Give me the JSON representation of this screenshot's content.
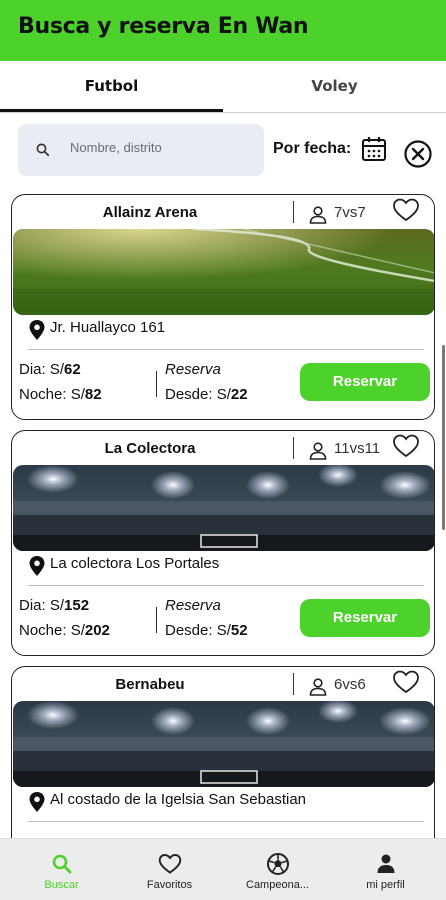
{
  "header": {
    "title": "Busca y reserva  En Wan"
  },
  "tabs": [
    {
      "label": "Futbol",
      "active": true
    },
    {
      "label": "Voley",
      "active": false
    }
  ],
  "search": {
    "placeholder": "Nombre, distrito",
    "icon": "search-icon"
  },
  "date_filter": {
    "label": "Por fecha:",
    "icon": "calendar-icon",
    "clear_icon": "close-circle-icon"
  },
  "cards": [
    {
      "name": "Allainz Arena",
      "capacity": "7vs7",
      "image": "grass-field",
      "address": "Jr. Huallayco  161",
      "day_label": "Dia: S/",
      "day_price": "62",
      "night_label": "Noche: S/",
      "night_price": "82",
      "reserve_label": "Reserva",
      "from_label": "Desde: S/",
      "from_price": "22",
      "button": "Reservar"
    },
    {
      "name": "La Colectora",
      "capacity": "11vs11",
      "image": "stadium-lights",
      "address": "La colectora Los Portales",
      "day_label": "Dia: S/",
      "day_price": "152",
      "night_label": "Noche: S/",
      "night_price": "202",
      "reserve_label": "Reserva",
      "from_label": "Desde: S/",
      "from_price": "52",
      "button": "Reservar"
    },
    {
      "name": "Bernabeu",
      "capacity": "6vs6",
      "image": "stadium-lights",
      "address": "Al costado de la Igelsia San Sebastian"
    }
  ],
  "bottom_nav": [
    {
      "label": "Buscar",
      "icon": "search-icon",
      "active": true
    },
    {
      "label": "Favoritos",
      "icon": "heart-icon",
      "active": false
    },
    {
      "label": "Campeona...",
      "icon": "soccer-ball-icon",
      "active": false
    },
    {
      "label": "mi perfil",
      "icon": "user-icon",
      "active": false
    }
  ],
  "colors": {
    "accent": "#4cd22a",
    "search_bg": "#e9ecf3",
    "nav_bg": "#ececec"
  }
}
